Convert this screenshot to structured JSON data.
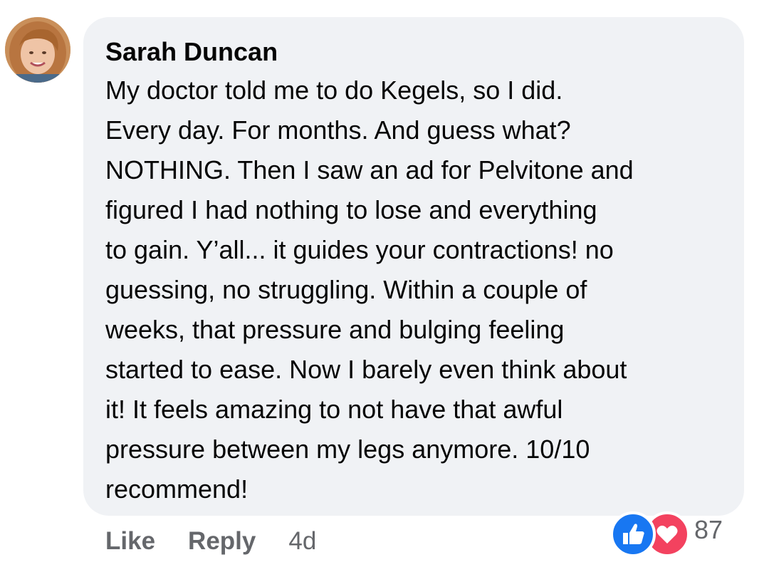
{
  "comment": {
    "author": "Sarah Duncan",
    "text_lines": [
      "My doctor told me to do Kegels, so I did.",
      "Every day. For months. And guess what?",
      "NOTHING. Then I saw an ad for Pelvitone and",
      "figured I had nothing to lose and everything",
      "to gain. Y’all... it guides your contractions! no",
      "guessing, no struggling. Within a couple of",
      "weeks, that pressure and bulging feeling",
      "started to ease. Now I barely even think about",
      "it! It feels amazing to not have that awful",
      "pressure between my legs anymore. 10/10",
      "recommend!"
    ],
    "avatar_icon": "user-avatar-photo"
  },
  "actions": {
    "like_label": "Like",
    "reply_label": "Reply",
    "timestamp": "4d"
  },
  "reactions": {
    "icons": [
      "like-icon",
      "love-icon"
    ],
    "count": "87"
  },
  "colors": {
    "bubble_bg": "#f0f2f5",
    "secondary_text": "#65676b",
    "like_blue": "#1877f2",
    "love_red": "#f3425f"
  }
}
